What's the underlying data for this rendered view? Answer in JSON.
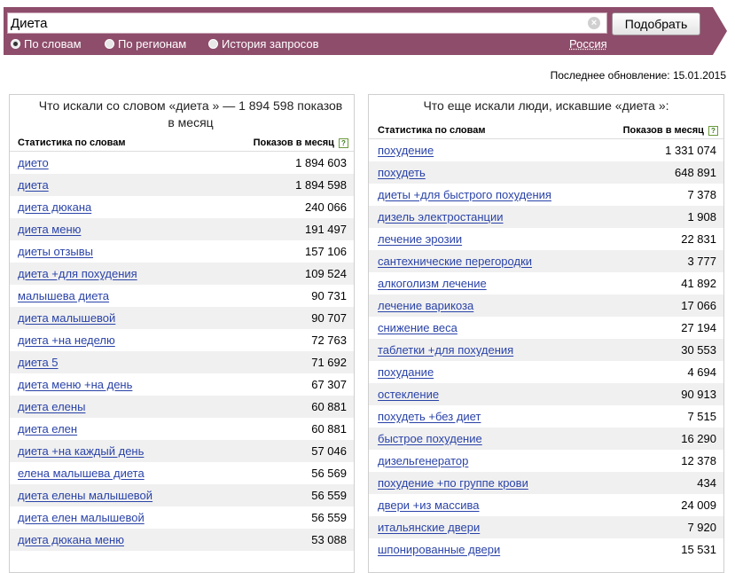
{
  "search": {
    "query": "Диета",
    "button_label": "Подобрать",
    "clear_icon": "×",
    "modes": [
      {
        "label": "По словам",
        "selected": true
      },
      {
        "label": "По регионам",
        "selected": false
      },
      {
        "label": "История запросов",
        "selected": false
      }
    ],
    "region": "Россия"
  },
  "last_update": "Последнее обновление: 15.01.2015",
  "left_panel": {
    "title": "Что искали со словом «диета » — 1 894 598 показов в месяц",
    "col_keyword": "Статистика по словам",
    "col_count": "Показов в месяц",
    "help": "?",
    "rows": [
      {
        "keyword": "дието",
        "count": "1 894 603"
      },
      {
        "keyword": "диета",
        "count": "1 894 598"
      },
      {
        "keyword": "диета дюкана",
        "count": "240 066"
      },
      {
        "keyword": "диета меню",
        "count": "191 497"
      },
      {
        "keyword": "диеты отзывы",
        "count": "157 106"
      },
      {
        "keyword": "диета +для похудения",
        "count": "109 524"
      },
      {
        "keyword": "малышева диета",
        "count": "90 731"
      },
      {
        "keyword": "диета малышевой",
        "count": "90 707"
      },
      {
        "keyword": "диета +на неделю",
        "count": "72 763"
      },
      {
        "keyword": "диета 5",
        "count": "71 692"
      },
      {
        "keyword": "диета меню +на день",
        "count": "67 307"
      },
      {
        "keyword": "диета елены",
        "count": "60 881"
      },
      {
        "keyword": "диета елен",
        "count": "60 881"
      },
      {
        "keyword": "диета +на каждый день",
        "count": "57 046"
      },
      {
        "keyword": "елена малышева диета",
        "count": "56 569"
      },
      {
        "keyword": "диета елены малышевой",
        "count": "56 559"
      },
      {
        "keyword": "диета елен малышевой",
        "count": "56 559"
      },
      {
        "keyword": "диета дюкана меню",
        "count": "53 088"
      }
    ]
  },
  "right_panel": {
    "title": "Что еще искали люди, искавшие «диета »:",
    "col_keyword": "Статистика по словам",
    "col_count": "Показов в месяц",
    "help": "?",
    "rows": [
      {
        "keyword": "похудение",
        "count": "1 331 074"
      },
      {
        "keyword": "похудеть",
        "count": "648 891"
      },
      {
        "keyword": "диеты +для быстрого похудения",
        "count": "7 378"
      },
      {
        "keyword": "дизель электростанции",
        "count": "1 908"
      },
      {
        "keyword": "лечение эрозии",
        "count": "22 831"
      },
      {
        "keyword": "сантехнические перегородки",
        "count": "3 777"
      },
      {
        "keyword": "алкоголизм лечение",
        "count": "41 892"
      },
      {
        "keyword": "лечение варикоза",
        "count": "17 066"
      },
      {
        "keyword": "снижение веса",
        "count": "27 194"
      },
      {
        "keyword": "таблетки +для похудения",
        "count": "30 553"
      },
      {
        "keyword": "похудание",
        "count": "4 694"
      },
      {
        "keyword": "остекление",
        "count": "90 913"
      },
      {
        "keyword": "похудеть +без диет",
        "count": "7 515"
      },
      {
        "keyword": "быстрое похудение",
        "count": "16 290"
      },
      {
        "keyword": "дизельгенератор",
        "count": "12 378"
      },
      {
        "keyword": "похудение +по группе крови",
        "count": "434"
      },
      {
        "keyword": "двери +из массива",
        "count": "24 009"
      },
      {
        "keyword": "итальянские двери",
        "count": "7 920"
      },
      {
        "keyword": "шпонированные двери",
        "count": "15 531"
      }
    ]
  }
}
